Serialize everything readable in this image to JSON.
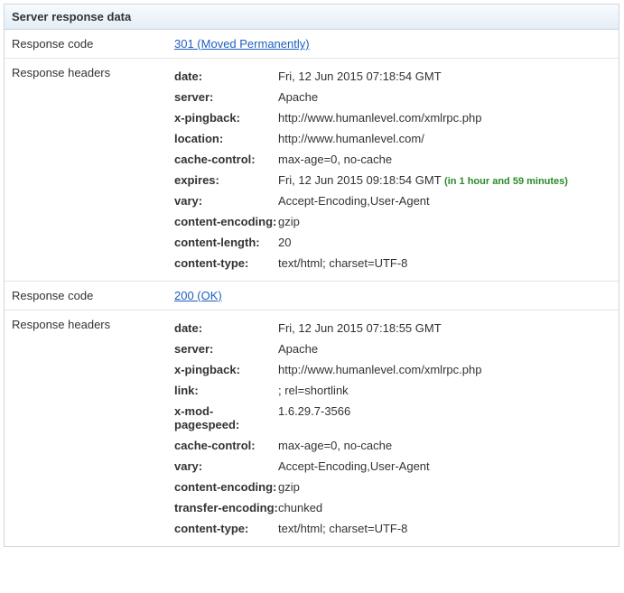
{
  "panel": {
    "title": "Server response data",
    "rows": [
      {
        "label": "Response code",
        "type": "link",
        "value": "301 (Moved Permanently)"
      },
      {
        "label": "Response headers",
        "type": "headers",
        "headers": [
          {
            "key": "date:",
            "value": "Fri, 12 Jun 2015 07:18:54 GMT"
          },
          {
            "key": "server:",
            "value": "Apache"
          },
          {
            "key": "x-pingback:",
            "value": "http://www.humanlevel.com/xmlrpc.php"
          },
          {
            "key": "location:",
            "value": "http://www.humanlevel.com/"
          },
          {
            "key": "cache-control:",
            "value": "max-age=0, no-cache"
          },
          {
            "key": "expires:",
            "value": "Fri, 12 Jun 2015 09:18:54 GMT",
            "extra": "(in 1 hour and 59 minutes)"
          },
          {
            "key": "vary:",
            "value": "Accept-Encoding,User-Agent"
          },
          {
            "key": "content-encoding:",
            "value": "gzip"
          },
          {
            "key": "content-length:",
            "value": "20"
          },
          {
            "key": "content-type:",
            "value": "text/html; charset=UTF-8"
          }
        ]
      },
      {
        "label": "Response code",
        "type": "link",
        "value": "200 (OK)"
      },
      {
        "label": "Response headers",
        "type": "headers",
        "headers": [
          {
            "key": "date:",
            "value": "Fri, 12 Jun 2015 07:18:55 GMT"
          },
          {
            "key": "server:",
            "value": "Apache"
          },
          {
            "key": "x-pingback:",
            "value": "http://www.humanlevel.com/xmlrpc.php"
          },
          {
            "key": "link:",
            "value": "; rel=shortlink"
          },
          {
            "key": "x-mod-pagespeed:",
            "value": "1.6.29.7-3566"
          },
          {
            "key": "cache-control:",
            "value": "max-age=0, no-cache"
          },
          {
            "key": "vary:",
            "value": "Accept-Encoding,User-Agent"
          },
          {
            "key": "content-encoding:",
            "value": "gzip"
          },
          {
            "key": "transfer-encoding:",
            "value": "chunked"
          },
          {
            "key": "content-type:",
            "value": "text/html; charset=UTF-8"
          }
        ]
      }
    ]
  }
}
